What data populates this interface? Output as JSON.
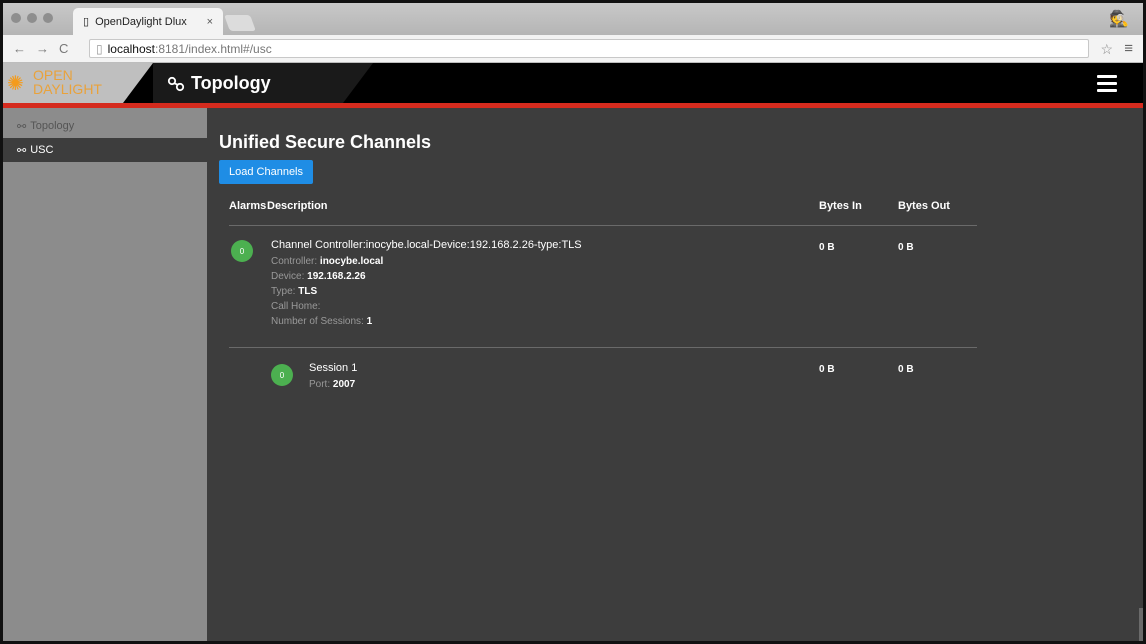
{
  "browser": {
    "tab_title": "OpenDaylight Dlux",
    "tab_close": "×",
    "url_host": "localhost",
    "url_path": ":8181/index.html#/usc"
  },
  "app": {
    "logo_line1": "OPEN",
    "logo_line2": "DAYLIGHT",
    "title": "Topology"
  },
  "sidebar": {
    "items": [
      {
        "label": "Topology"
      },
      {
        "label": "USC"
      }
    ]
  },
  "main": {
    "heading": "Unified Secure Channels",
    "load_button": "Load Channels",
    "columns": {
      "alarms": "Alarms",
      "description": "Description",
      "bytes_in": "Bytes In",
      "bytes_out": "Bytes Out"
    },
    "channel": {
      "alarm_count": "0",
      "title": "Channel Controller:inocybe.local-Device:192.168.2.26-type:TLS",
      "controller_label": "Controller:",
      "controller_value": "inocybe.local",
      "device_label": "Device:",
      "device_value": "192.168.2.26",
      "type_label": "Type:",
      "type_value": "TLS",
      "callhome_label": "Call Home:",
      "sessions_label": "Number of Sessions:",
      "sessions_value": "1",
      "bytes_in": "0 B",
      "bytes_out": "0 B"
    },
    "session": {
      "alarm_count": "0",
      "title": "Session 1",
      "port_label": "Port:",
      "port_value": "2007",
      "bytes_in": "0 B",
      "bytes_out": "0 B"
    }
  }
}
